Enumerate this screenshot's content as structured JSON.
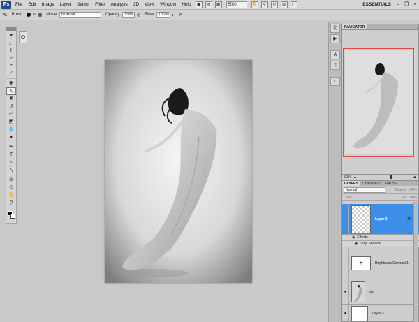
{
  "menubar": {
    "logo": "Ps",
    "items": [
      "File",
      "Edit",
      "Image",
      "Layer",
      "Select",
      "Filter",
      "Analysis",
      "3D",
      "View",
      "Window",
      "Help"
    ],
    "zoom": "50%",
    "workspace": "ESSENTIALS"
  },
  "options": {
    "brush_label": "Brush:",
    "brush_size": "19",
    "mode_label": "Mode:",
    "mode_value": "Normal",
    "opacity_label": "Opacity:",
    "opacity_value": "30%",
    "flow_label": "Flow:",
    "flow_value": "100%"
  },
  "navigator": {
    "tabs": [
      "NAVIGATOR"
    ],
    "zoom": "50%"
  },
  "layers_panel": {
    "tabs": [
      "LAYERS",
      "CHANNELS",
      "PATHS"
    ],
    "blend_mode": "Normal",
    "opacity_label": "Opacity: 100%",
    "lock_label": "Lock:",
    "fill_label": "Fill: 100%",
    "layers": [
      {
        "name": "Layer 2",
        "selected": true,
        "fx": "fx"
      },
      {
        "name": "Effects"
      },
      {
        "name": "Drop Shadow"
      },
      {
        "name": "Brightness/Contrast 1"
      },
      {
        "name": "da"
      },
      {
        "name": "Layer 3"
      }
    ]
  },
  "colors": {
    "selected_layer": "#3d8ee8",
    "navigator_box": "#e24848",
    "logo_bg": "#1a4f8e"
  }
}
